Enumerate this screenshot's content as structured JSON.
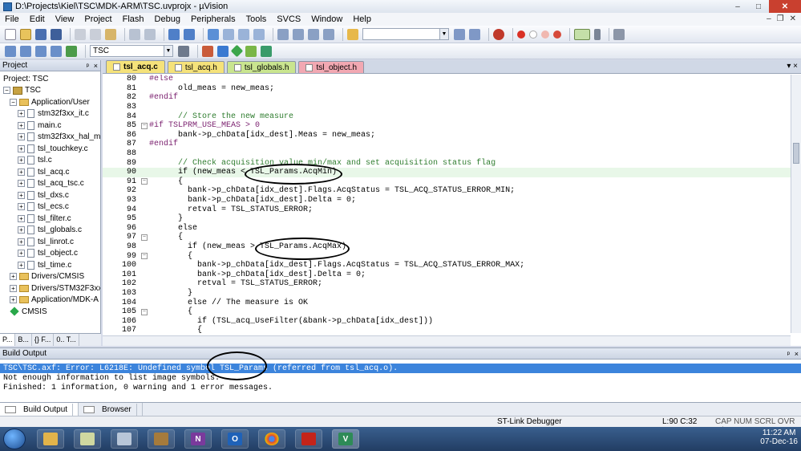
{
  "window": {
    "title": "D:\\Projects\\Kiel\\TSC\\MDK-ARM\\TSC.uvprojx - µVision",
    "min": "–",
    "max": "□",
    "close": "✕"
  },
  "menubar": {
    "items": [
      "File",
      "Edit",
      "View",
      "Project",
      "Flash",
      "Debug",
      "Peripherals",
      "Tools",
      "SVCS",
      "Window",
      "Help"
    ],
    "win_min": "–",
    "win_restore": "❐",
    "win_close": "✕"
  },
  "toolbar2": {
    "target_value": "TSC"
  },
  "project_pane": {
    "title": "Project",
    "pin": "ᵖ",
    "close": "×",
    "root": "Project: TSC",
    "target": "TSC",
    "group_app": "Application/User",
    "files": [
      "stm32f3xx_it.c",
      "main.c",
      "stm32f3xx_hal_m",
      "tsl_touchkey.c",
      "tsl.c",
      "tsl_acq.c",
      "tsl_acq_tsc.c",
      "tsl_dxs.c",
      "tsl_ecs.c",
      "tsl_filter.c",
      "tsl_globals.c",
      "tsl_linrot.c",
      "tsl_object.c",
      "tsl_time.c"
    ],
    "groups_other": [
      "Drivers/CMSIS",
      "Drivers/STM32F3xx_",
      "Application/MDK-A"
    ],
    "cmsis": "CMSIS",
    "tabs": [
      "P...",
      "B...",
      "{} F...",
      "0.. T..."
    ]
  },
  "editor": {
    "tabs": [
      {
        "label": "tsl_acq.c",
        "color": "#f5e27a"
      },
      {
        "label": "tsl_acq.h",
        "color": "#f5e27a"
      },
      {
        "label": "tsl_globals.h",
        "color": "#c9e58f"
      },
      {
        "label": "tsl_object.h",
        "color": "#f2a8b2"
      }
    ],
    "tab_close": "▾ ×",
    "lines": [
      {
        "n": "80",
        "t": "#else",
        "c": "pp",
        "f": ""
      },
      {
        "n": "81",
        "t": "      old_meas = new_meas;",
        "c": "code",
        "f": ""
      },
      {
        "n": "82",
        "t": "#endif",
        "c": "pp",
        "f": ""
      },
      {
        "n": "83",
        "t": "",
        "c": "code",
        "f": ""
      },
      {
        "n": "84",
        "t": "      // Store the new measure",
        "c": "cmt",
        "f": ""
      },
      {
        "n": "85",
        "t": "#if TSLPRM_USE_MEAS > 0",
        "c": "pp",
        "f": "⊟"
      },
      {
        "n": "86",
        "t": "      bank->p_chData[idx_dest].Meas = new_meas;",
        "c": "code",
        "f": ""
      },
      {
        "n": "87",
        "t": "#endif",
        "c": "pp",
        "f": ""
      },
      {
        "n": "88",
        "t": "",
        "c": "code",
        "f": ""
      },
      {
        "n": "89",
        "t": "      // Check acquisition value min/max and set acquisition status flag",
        "c": "cmt",
        "f": ""
      },
      {
        "n": "90",
        "t": "      if (new_meas < TSL_Params.AcqMin)",
        "c": "code",
        "f": ""
      },
      {
        "n": "91",
        "t": "      {",
        "c": "code",
        "f": "⊟"
      },
      {
        "n": "92",
        "t": "        bank->p_chData[idx_dest].Flags.AcqStatus = TSL_ACQ_STATUS_ERROR_MIN;",
        "c": "code",
        "f": ""
      },
      {
        "n": "93",
        "t": "        bank->p_chData[idx_dest].Delta = 0;",
        "c": "code",
        "f": ""
      },
      {
        "n": "94",
        "t": "        retval = TSL_STATUS_ERROR;",
        "c": "code",
        "f": ""
      },
      {
        "n": "95",
        "t": "      }",
        "c": "code",
        "f": ""
      },
      {
        "n": "96",
        "t": "      else",
        "c": "code",
        "f": ""
      },
      {
        "n": "97",
        "t": "      {",
        "c": "code",
        "f": "⊟"
      },
      {
        "n": "98",
        "t": "        if (new_meas > TSL_Params.AcqMax)",
        "c": "code",
        "f": ""
      },
      {
        "n": "99",
        "t": "        {",
        "c": "code",
        "f": "⊟"
      },
      {
        "n": "100",
        "t": "          bank->p_chData[idx_dest].Flags.AcqStatus = TSL_ACQ_STATUS_ERROR_MAX;",
        "c": "code",
        "f": ""
      },
      {
        "n": "101",
        "t": "          bank->p_chData[idx_dest].Delta = 0;",
        "c": "code",
        "f": ""
      },
      {
        "n": "102",
        "t": "          retval = TSL_STATUS_ERROR;",
        "c": "code",
        "f": ""
      },
      {
        "n": "103",
        "t": "        }",
        "c": "code",
        "f": ""
      },
      {
        "n": "104",
        "t": "        else // The measure is OK",
        "c": "code",
        "f": ""
      },
      {
        "n": "105",
        "t": "        {",
        "c": "code",
        "f": "⊟"
      },
      {
        "n": "106",
        "t": "          if (TSL_acq_UseFilter(&bank->p_chData[idx_dest]))",
        "c": "code",
        "f": ""
      },
      {
        "n": "107",
        "t": "          {",
        "c": "code",
        "f": ""
      }
    ],
    "highlight_line": "90"
  },
  "build_output": {
    "title": "Build Output",
    "pin": "ᵖ",
    "close": "×",
    "lines": [
      "TSC\\TSC.axf: Error: L6218E: Undefined symbol TSL_Params (referred from tsl_acq.o).",
      "Not enough information to list image symbols.",
      "Finished: 1 information, 0 warning and 1 error messages."
    ],
    "tabs": [
      "Build Output",
      "Browser"
    ]
  },
  "status": {
    "debugger": "ST-Link Debugger",
    "position": "L:90 C:32",
    "keys": "CAP  NUM  SCRL  OVR  R/W"
  },
  "taskbar": {
    "time": "11:22 AM",
    "date": "07-Dec-16"
  }
}
